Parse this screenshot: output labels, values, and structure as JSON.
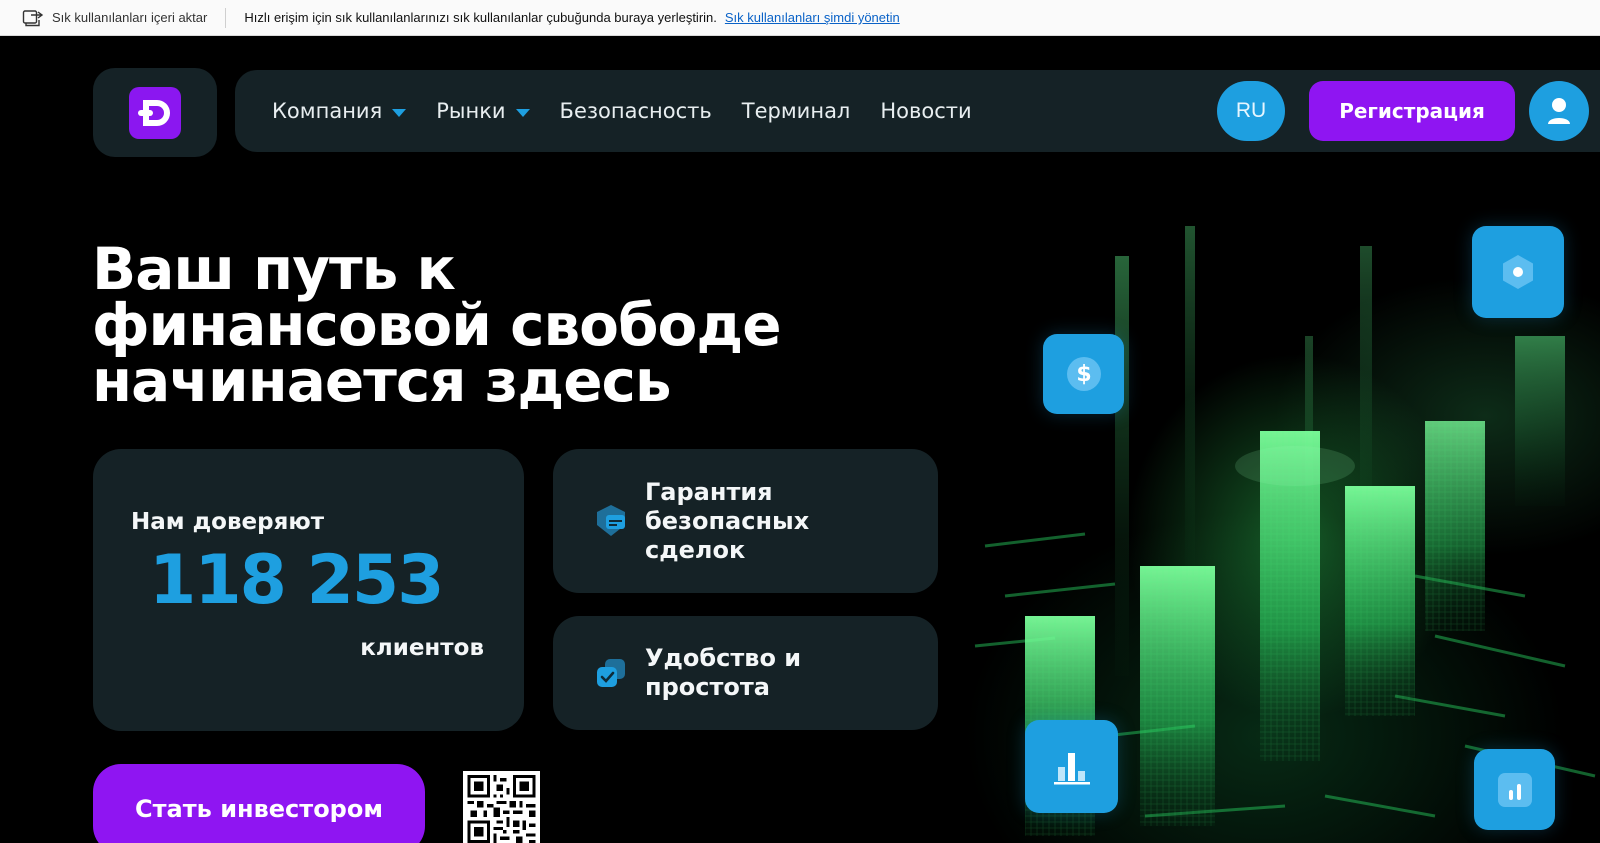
{
  "bookmarks_bar": {
    "import_label": "Sık kullanılanları içeri aktar",
    "hint": "Hızlı erişim için sık kullanılanlarınızı sık kullanılanlar çubuğunda buraya yerleştirin.",
    "manage_link": "Sık kullanılanları şimdi yönetin"
  },
  "header": {
    "nav": [
      {
        "label": "Компания",
        "dropdown": true
      },
      {
        "label": "Рынки",
        "dropdown": true
      },
      {
        "label": "Безопасность",
        "dropdown": false
      },
      {
        "label": "Терминал",
        "dropdown": false
      },
      {
        "label": "Новости",
        "dropdown": false
      }
    ],
    "language": "RU",
    "register_label": "Регистрация"
  },
  "hero": {
    "headline_lines": [
      "Ваш путь к",
      "финансовой свободе",
      "начинается здесь"
    ],
    "trust": {
      "label": "Нам доверяют",
      "count": "118 253",
      "suffix": "клиентов"
    },
    "features": [
      {
        "text_lines": [
          "Гарантия",
          "безопасных",
          "сделок"
        ],
        "icon": "shield-card-icon"
      },
      {
        "text_lines": [
          "Удобство и",
          "простота"
        ],
        "icon": "checkbox-stack-icon"
      }
    ],
    "cta_label": "Стать инвестором"
  },
  "colors": {
    "accent_purple": "#8f15f2",
    "accent_blue": "#1e9fe0",
    "panel": "#152226",
    "background": "#000000"
  }
}
